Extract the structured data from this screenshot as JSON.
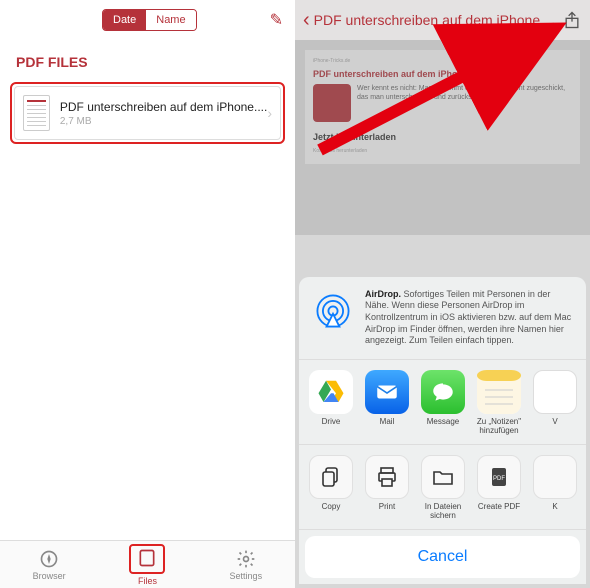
{
  "left": {
    "sort": {
      "date": "Date",
      "name": "Name"
    },
    "section_title": "PDF FILES",
    "file": {
      "name": "PDF unterschreiben auf dem iPhone....",
      "size": "2,7 MB"
    },
    "tabs": {
      "browser": "Browser",
      "files": "Files",
      "settings": "Settings"
    }
  },
  "right": {
    "title": "PDF unterschreiben auf dem iPhone...",
    "doc": {
      "site": "iPhone-Tricks.de",
      "h1": "PDF unterschreiben auf dem iPhone",
      "blurb": "Wer kennt es nicht: Man bekommt ein PDF-Dokument zugeschickt, das man unterschreiben und zurücksenden soll...",
      "h2": "Jetzt herunterladen",
      "sub": "Kostenlos herunterladen"
    },
    "airdrop": {
      "bold": "AirDrop.",
      "text": " Sofortiges Teilen mit Personen in der Nähe. Wenn diese Personen AirDrop im Kontrollzentrum in iOS aktivieren bzw. auf dem Mac AirDrop im Finder öffnen, werden ihre Namen hier angezeigt. Zum Teilen einfach tippen."
    },
    "apps": [
      {
        "label": "Drive"
      },
      {
        "label": "Mail"
      },
      {
        "label": "Message"
      },
      {
        "label": "Zu „Notizen\" hinzufügen"
      },
      {
        "label": "V"
      }
    ],
    "actions": [
      {
        "label": "Copy"
      },
      {
        "label": "Print"
      },
      {
        "label": "In Dateien sichern"
      },
      {
        "label": "Create PDF"
      },
      {
        "label": "K"
      }
    ],
    "cancel": "Cancel"
  }
}
